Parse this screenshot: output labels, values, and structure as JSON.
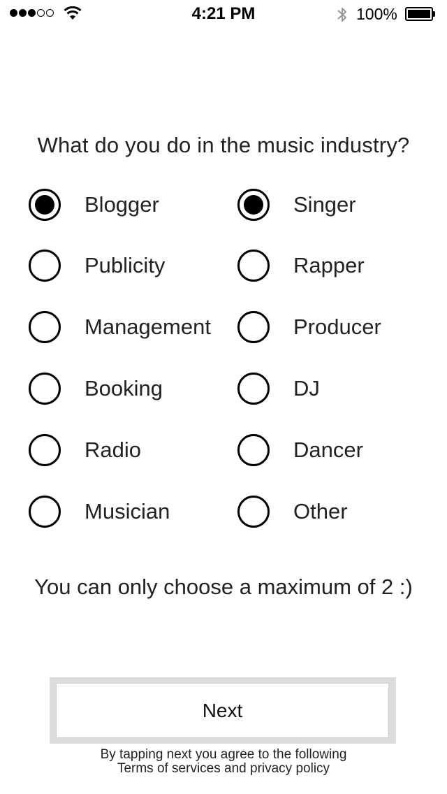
{
  "status_bar": {
    "time": "4:21 PM",
    "battery_percent": "100%",
    "signal_bars_filled": 3,
    "signal_bars_total": 5
  },
  "question": "What do you do in the music industry?",
  "options": {
    "left": [
      {
        "label": "Blogger",
        "selected": true
      },
      {
        "label": "Publicity",
        "selected": false
      },
      {
        "label": "Management",
        "selected": false
      },
      {
        "label": "Booking",
        "selected": false
      },
      {
        "label": "Radio",
        "selected": false
      },
      {
        "label": "Musician",
        "selected": false
      }
    ],
    "right": [
      {
        "label": "Singer",
        "selected": true
      },
      {
        "label": "Rapper",
        "selected": false
      },
      {
        "label": "Producer",
        "selected": false
      },
      {
        "label": "DJ",
        "selected": false
      },
      {
        "label": "Dancer",
        "selected": false
      },
      {
        "label": "Other",
        "selected": false
      }
    ]
  },
  "hint": "You can only choose a maximum of 2 :)",
  "next_button_label": "Next",
  "terms": {
    "line1": "By tapping next you agree to the following",
    "line2": "Terms of services and privacy policy"
  },
  "icons": {
    "wifi": "wifi-icon",
    "bluetooth": "bluetooth-icon",
    "battery": "battery-icon"
  }
}
